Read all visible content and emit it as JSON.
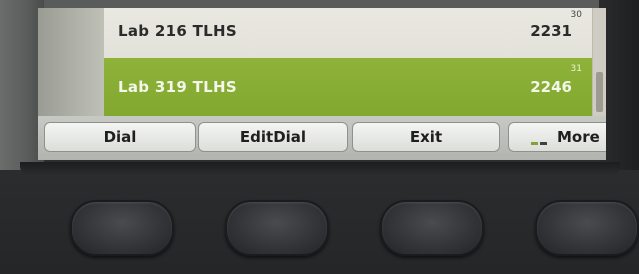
{
  "directory": {
    "entries": [
      {
        "name": "Lab 216 TLHS",
        "extension": "2231",
        "index": "30",
        "selected": false
      },
      {
        "name": "Lab 319 TLHS",
        "extension": "2246",
        "index": "31",
        "selected": true
      }
    ]
  },
  "softkeys": {
    "dial": "Dial",
    "editdial": "EditDial",
    "exit": "Exit",
    "more": "More"
  },
  "colors": {
    "selected_row": "#8eb23a",
    "row_background": "#e9e8e1",
    "softkey_background": "#eceeea",
    "more_indicator_green": "#7fa33a",
    "more_indicator_dark": "#404040"
  },
  "icons": {
    "more_indicator": "more-indicator-icon",
    "hardware_keys": "softkey-hardware-button"
  }
}
